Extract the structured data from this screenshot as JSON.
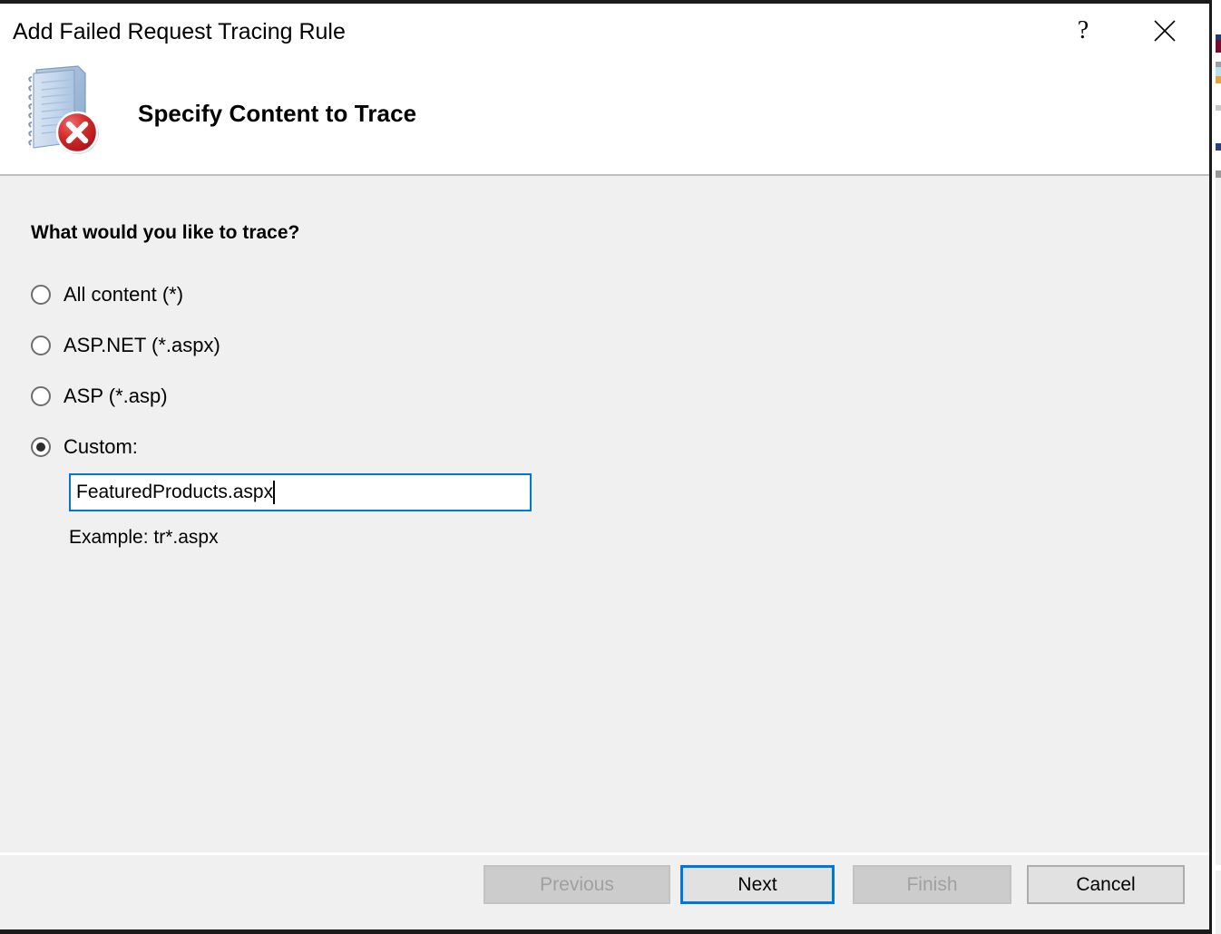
{
  "window": {
    "title": "Add Failed Request Tracing Rule",
    "help_button_label": "?",
    "close_button_label": "Close",
    "help_icon": "question-mark-icon",
    "close_icon": "close-icon"
  },
  "header": {
    "title": "Specify Content to Trace",
    "icon": "notebook-error-icon"
  },
  "content": {
    "question": "What would you like to trace?",
    "options": [
      {
        "label": "All content (*)",
        "selected": false,
        "name": "all-content"
      },
      {
        "label": "ASP.NET (*.aspx)",
        "selected": false,
        "name": "asp-net"
      },
      {
        "label": "ASP (*.asp)",
        "selected": false,
        "name": "asp"
      },
      {
        "label": "Custom:",
        "selected": true,
        "name": "custom"
      }
    ],
    "custom_input": {
      "value": "FeaturedProducts.aspx",
      "placeholder": ""
    },
    "example_text": "Example: tr*.aspx"
  },
  "footer": {
    "buttons": [
      {
        "label": "Previous",
        "state": "disabled",
        "name": "previous-button"
      },
      {
        "label": "Next",
        "state": "focused",
        "name": "next-button"
      },
      {
        "label": "Finish",
        "state": "disabled",
        "name": "finish-button"
      },
      {
        "label": "Cancel",
        "state": "normal",
        "name": "cancel-button"
      }
    ]
  },
  "colors": {
    "accent": "#0078d7",
    "dialog_background": "#f0f0f0",
    "header_background": "#ffffff",
    "error_badge": "#cc2027",
    "window_border": "#1b1b1b"
  }
}
